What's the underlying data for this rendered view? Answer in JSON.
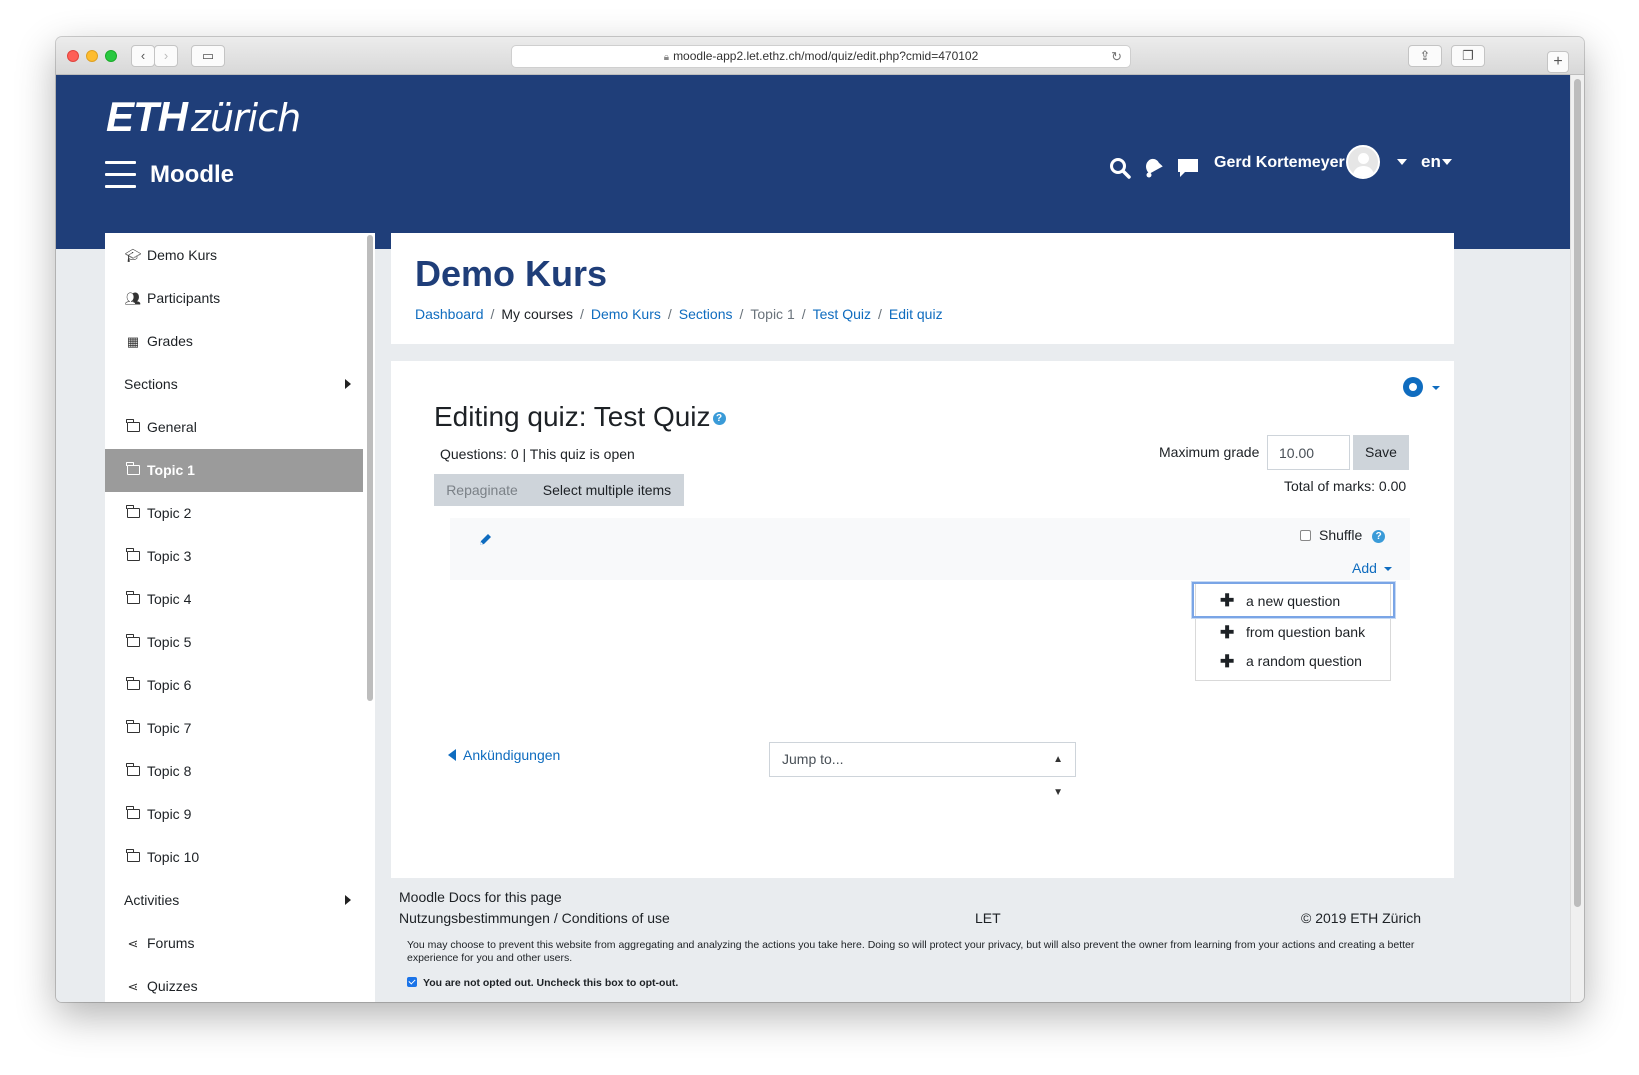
{
  "browser": {
    "url": "moodle-app2.let.ethz.ch/mod/quiz/edit.php?cmid=470102"
  },
  "header": {
    "logo_bold": "ETH",
    "logo_rest": "zürich",
    "site_name": "Moodle",
    "user_name": "Gerd Kortemeyer",
    "language": "en"
  },
  "sidebar": {
    "items": [
      {
        "label": "Demo Kurs",
        "icon": "graduation-cap-icon"
      },
      {
        "label": "Participants",
        "icon": "users-icon"
      },
      {
        "label": "Grades",
        "icon": "table-icon"
      },
      {
        "label": "Sections"
      },
      {
        "label": "General",
        "icon": "folder-icon"
      },
      {
        "label": "Topic 1",
        "icon": "folder-icon",
        "active": true
      },
      {
        "label": "Topic 2",
        "icon": "folder-icon"
      },
      {
        "label": "Topic 3",
        "icon": "folder-icon"
      },
      {
        "label": "Topic 4",
        "icon": "folder-icon"
      },
      {
        "label": "Topic 5",
        "icon": "folder-icon"
      },
      {
        "label": "Topic 6",
        "icon": "folder-icon"
      },
      {
        "label": "Topic 7",
        "icon": "folder-icon"
      },
      {
        "label": "Topic 8",
        "icon": "folder-icon"
      },
      {
        "label": "Topic 9",
        "icon": "folder-icon"
      },
      {
        "label": "Topic 10",
        "icon": "folder-icon"
      },
      {
        "label": "Activities"
      },
      {
        "label": "Forums",
        "icon": "share-icon"
      },
      {
        "label": "Quizzes",
        "icon": "share-icon"
      }
    ]
  },
  "course": {
    "title": "Demo Kurs",
    "breadcrumb": [
      "Dashboard",
      "My courses",
      "Demo Kurs",
      "Sections",
      "Topic 1",
      "Test Quiz",
      "Edit quiz"
    ]
  },
  "quiz": {
    "heading": "Editing quiz: Test Quiz",
    "help": "?",
    "status": "Questions: 0 | This quiz is open",
    "repaginate_label": "Repaginate",
    "select_multiple_label": "Select multiple items",
    "max_grade_label": "Maximum grade",
    "max_grade_value": "10.00",
    "save_label": "Save",
    "total_marks": "Total of marks: 0.00",
    "shuffle_label": "Shuffle",
    "add_label": "Add",
    "add_menu": [
      "a new question",
      "from question bank",
      "a random question"
    ],
    "prev_activity": "Ankündigungen",
    "jump_placeholder": "Jump to..."
  },
  "footer": {
    "docs": "Moodle Docs for this page",
    "terms": "Nutzungsbestimmungen / Conditions of use",
    "let": "LET",
    "copyright": "© 2019 ETH Zürich",
    "privacy": "You may choose to prevent this website from aggregating and analyzing the actions you take here. Doing so will protect your privacy, but will also prevent the owner from learning from your actions and creating a better experience for you and other users.",
    "optout": "You are not opted out. Uncheck this box to opt-out."
  },
  "colors": {
    "header_bg": "#1f3e79",
    "link": "#0f6cbf",
    "active_nav": "#9b9b9b"
  }
}
